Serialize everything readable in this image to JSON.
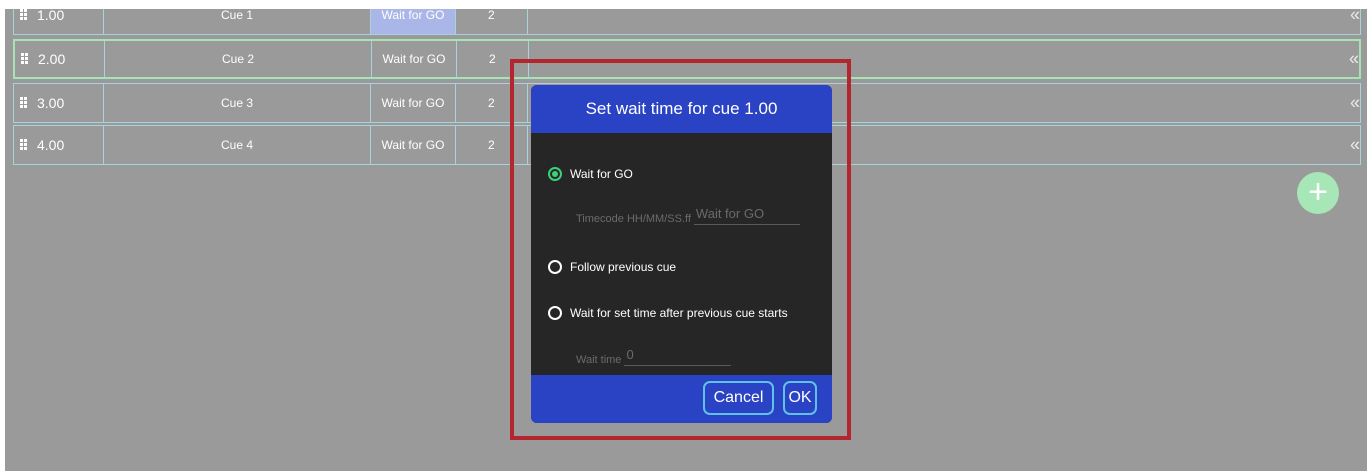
{
  "table": {
    "rows": [
      {
        "number": "1.00",
        "name": "Cue 1",
        "wait": "Wait for GO",
        "count": "2"
      },
      {
        "number": "2.00",
        "name": "Cue 2",
        "wait": "Wait for GO",
        "count": "2"
      },
      {
        "number": "3.00",
        "name": "Cue 3",
        "wait": "Wait for GO",
        "count": "2"
      },
      {
        "number": "4.00",
        "name": "Cue 4",
        "wait": "Wait for GO",
        "count": "2"
      }
    ]
  },
  "add_button": {
    "label": "+"
  },
  "dialog": {
    "title": "Set wait time for cue 1.00",
    "options": {
      "wait_for_go": "Wait for GO",
      "follow_previous": "Follow previous cue",
      "wait_set_time": "Wait for set time after previous cue starts"
    },
    "selected_option": "Wait for GO",
    "timecode_label": "Timecode HH/MM/SS.ff",
    "timecode_placeholder": "Wait for GO",
    "wait_time_label": "Wait time",
    "wait_time_value": "0",
    "cancel_label": "Cancel",
    "ok_label": "OK"
  },
  "icons": {
    "drag": "drag-handle-icon",
    "chevron": "chevron-double-left-icon",
    "add": "plus-icon"
  },
  "colors": {
    "dialog_blue": "#2a42c4",
    "highlight": "#b3262d",
    "radio_active": "#3bd17a",
    "add_button": "#a7e6b6"
  }
}
